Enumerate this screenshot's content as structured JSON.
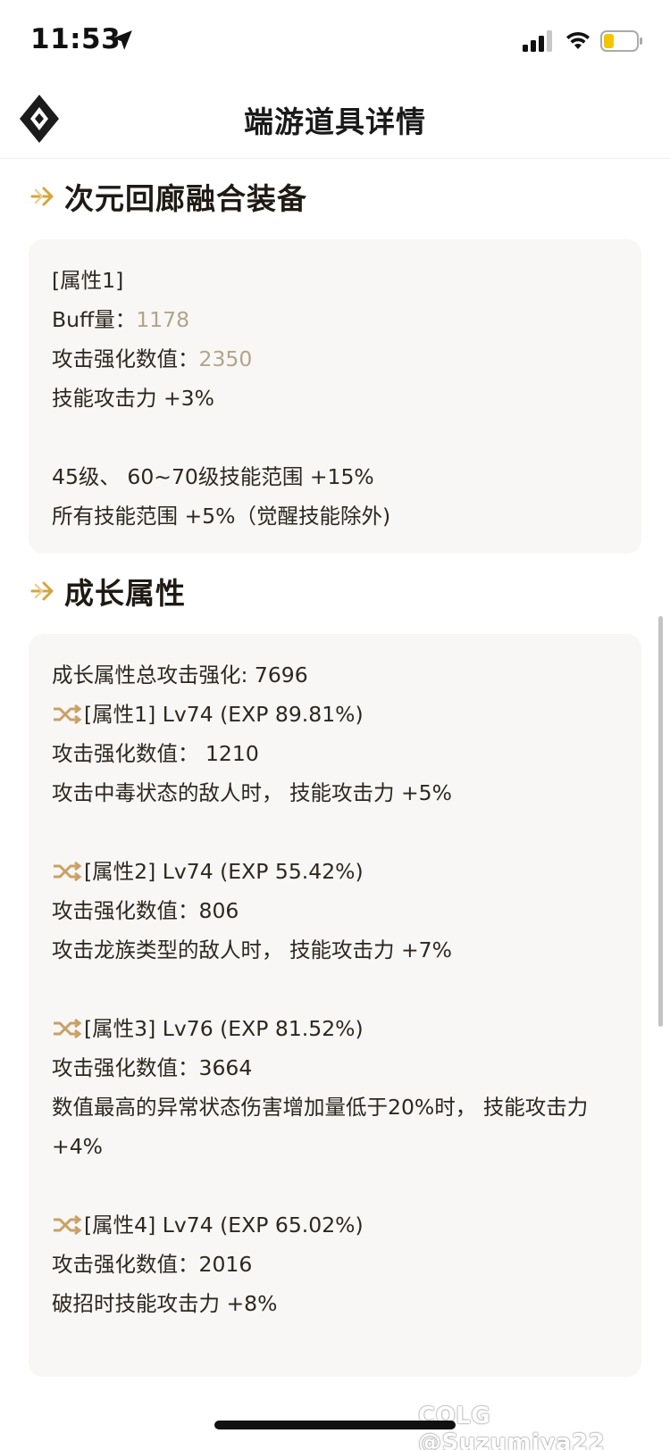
{
  "status_bar": {
    "time": "11:53",
    "icons": [
      "location-arrow-icon",
      "signal-icon",
      "wifi-icon",
      "battery-icon"
    ]
  },
  "header": {
    "title": "端游道具详情",
    "logo_icon": "diamond-logo-icon"
  },
  "colors": {
    "accent_gold": "#d9a43c",
    "value_gold": "#b3a489",
    "card_bg": "#f8f7f6",
    "text": "#2d271f"
  },
  "fusion_section": {
    "title": "次元回廊融合装备",
    "attr_label": "[属性1]",
    "buff_label": "Buff量：",
    "buff_value": "1178",
    "atk_label": "攻击强化数值：",
    "atk_value": "2350",
    "skill_atk": "技能攻击力 +3%",
    "range_1": "45级、 60~70级技能范围 +15%",
    "range_2": "所有技能范围 +5%（觉醒技能除外)"
  },
  "growth_section": {
    "title": "成长属性",
    "total": "成长属性总攻击强化: 7696",
    "attrs": [
      {
        "head": "[属性1] Lv74 (EXP 89.81%)",
        "atk": "攻击强化数值： 1210",
        "effect": "攻击中毒状态的敌人时， 技能攻击力 +5%"
      },
      {
        "head": "[属性2] Lv74 (EXP 55.42%)",
        "atk": "攻击强化数值：806",
        "effect": "攻击龙族类型的敌人时， 技能攻击力 +7%"
      },
      {
        "head": "[属性3] Lv76 (EXP 81.52%)",
        "atk": "攻击强化数值：3664",
        "effect": "数值最高的异常状态伤害增加量低于20%时， 技能攻击力 +4%"
      },
      {
        "head": "[属性4] Lv74 (EXP 65.02%)",
        "atk": "攻击强化数值：2016",
        "effect": "破招时技能攻击力 +8%"
      }
    ]
  },
  "watermark": "COLG @Suzumiya22"
}
